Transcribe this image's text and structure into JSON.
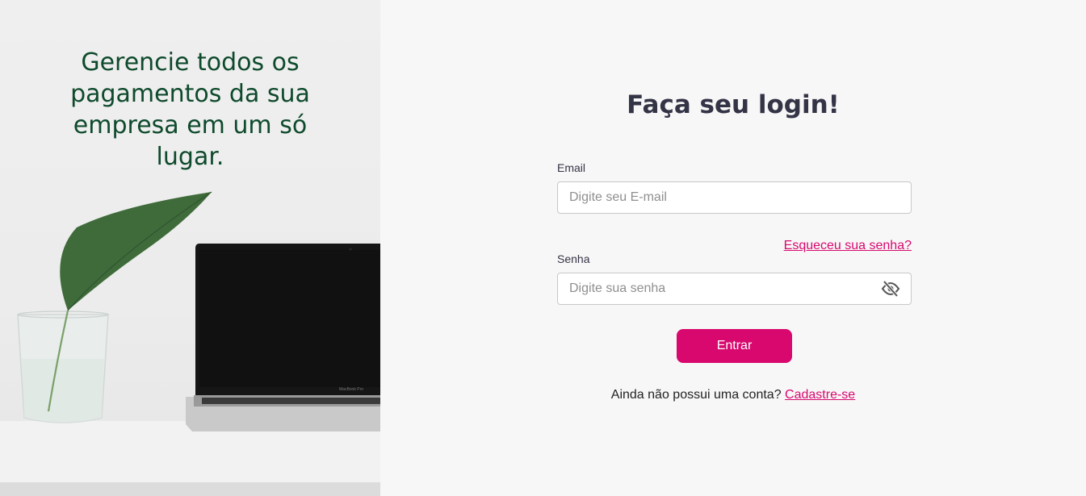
{
  "hero": {
    "headline": "Gerencie todos os pagamentos da sua empresa em um só lugar.",
    "laptop_brand": "MacBook Pro"
  },
  "login": {
    "title": "Faça seu login!",
    "email_label": "Email",
    "email_placeholder": "Digite seu E-mail",
    "password_label": "Senha",
    "password_placeholder": "Digite sua senha",
    "forgot_password": "Esqueceu sua senha?",
    "submit_label": "Entrar",
    "signup_prompt": "Ainda não possui uma conta?",
    "signup_link": "Cadastre-se"
  },
  "colors": {
    "accent": "#d8086f",
    "headline": "#0e4a2c",
    "title": "#343447"
  },
  "icons": {
    "password_toggle": "eye-off-icon"
  }
}
